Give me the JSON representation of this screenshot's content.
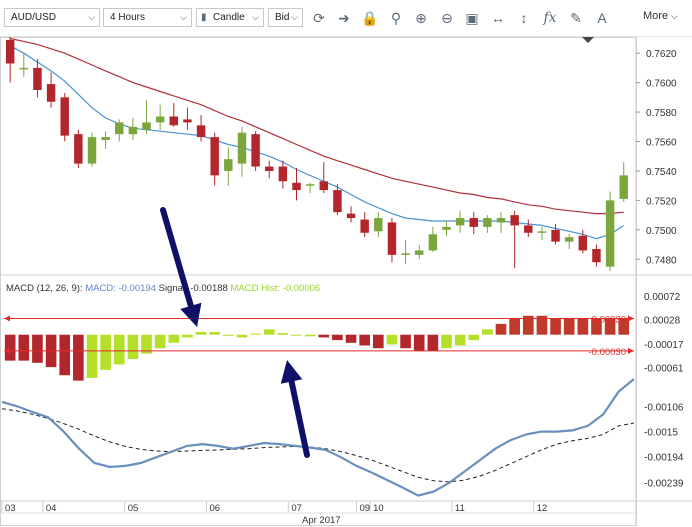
{
  "toolbar": {
    "symbol": "AUD/USD",
    "interval": "4 Hours",
    "chart_type": "Candle",
    "price_type": "Bid",
    "more_label": "More",
    "icons": [
      "refresh-icon",
      "arrow-right-icon",
      "lock-icon",
      "zoom-reset-icon",
      "zoom-in-icon",
      "zoom-out-icon",
      "zoom-fit-icon",
      "horizontal-resize-icon",
      "vertical-resize-icon",
      "function-icon",
      "pencil-icon",
      "text-tool-icon"
    ]
  },
  "chart_data": {
    "type": "candlestick",
    "symbol": "AUD/USD",
    "price_axis": {
      "ticks": [
        "0.7620",
        "0.7600",
        "0.7580",
        "0.7560",
        "0.7540",
        "0.7520",
        "0.7500",
        "0.7480"
      ],
      "range": [
        0.747,
        0.7631
      ]
    },
    "candles": [
      {
        "o": 0.7629,
        "h": 0.7632,
        "l": 0.76,
        "c": 0.7613
      },
      {
        "o": 0.761,
        "h": 0.762,
        "l": 0.7604,
        "c": 0.761
      },
      {
        "o": 0.761,
        "h": 0.7616,
        "l": 0.759,
        "c": 0.7595
      },
      {
        "o": 0.7599,
        "h": 0.7607,
        "l": 0.7583,
        "c": 0.7587
      },
      {
        "o": 0.759,
        "h": 0.7593,
        "l": 0.756,
        "c": 0.7564
      },
      {
        "o": 0.7565,
        "h": 0.7568,
        "l": 0.7542,
        "c": 0.7545
      },
      {
        "o": 0.7545,
        "h": 0.7566,
        "l": 0.7543,
        "c": 0.7563
      },
      {
        "o": 0.7561,
        "h": 0.7567,
        "l": 0.7555,
        "c": 0.7563
      },
      {
        "o": 0.7565,
        "h": 0.7575,
        "l": 0.756,
        "c": 0.7573
      },
      {
        "o": 0.7565,
        "h": 0.7576,
        "l": 0.7561,
        "c": 0.757
      },
      {
        "o": 0.7568,
        "h": 0.7588,
        "l": 0.7565,
        "c": 0.7573
      },
      {
        "o": 0.7573,
        "h": 0.7585,
        "l": 0.7568,
        "c": 0.7577
      },
      {
        "o": 0.7577,
        "h": 0.7586,
        "l": 0.757,
        "c": 0.7571
      },
      {
        "o": 0.7575,
        "h": 0.7583,
        "l": 0.7568,
        "c": 0.7573
      },
      {
        "o": 0.7571,
        "h": 0.7578,
        "l": 0.756,
        "c": 0.7563
      },
      {
        "o": 0.7563,
        "h": 0.7566,
        "l": 0.753,
        "c": 0.7537
      },
      {
        "o": 0.754,
        "h": 0.7556,
        "l": 0.753,
        "c": 0.7548
      },
      {
        "o": 0.7545,
        "h": 0.757,
        "l": 0.7536,
        "c": 0.7566
      },
      {
        "o": 0.7565,
        "h": 0.7567,
        "l": 0.754,
        "c": 0.7543
      },
      {
        "o": 0.7543,
        "h": 0.7547,
        "l": 0.7535,
        "c": 0.754
      },
      {
        "o": 0.7543,
        "h": 0.7547,
        "l": 0.7528,
        "c": 0.7533
      },
      {
        "o": 0.7532,
        "h": 0.7542,
        "l": 0.752,
        "c": 0.7527
      },
      {
        "o": 0.753,
        "h": 0.7532,
        "l": 0.7525,
        "c": 0.7531
      },
      {
        "o": 0.7533,
        "h": 0.7546,
        "l": 0.7525,
        "c": 0.7527
      },
      {
        "o": 0.7527,
        "h": 0.7531,
        "l": 0.751,
        "c": 0.7512
      },
      {
        "o": 0.7511,
        "h": 0.7516,
        "l": 0.7505,
        "c": 0.7508
      },
      {
        "o": 0.7507,
        "h": 0.7512,
        "l": 0.7495,
        "c": 0.7498
      },
      {
        "o": 0.7499,
        "h": 0.7512,
        "l": 0.7495,
        "c": 0.7508
      },
      {
        "o": 0.7505,
        "h": 0.7508,
        "l": 0.7478,
        "c": 0.7483
      },
      {
        "o": 0.7484,
        "h": 0.7493,
        "l": 0.7477,
        "c": 0.7484
      },
      {
        "o": 0.7483,
        "h": 0.749,
        "l": 0.748,
        "c": 0.7486
      },
      {
        "o": 0.7486,
        "h": 0.7502,
        "l": 0.7485,
        "c": 0.7497
      },
      {
        "o": 0.75,
        "h": 0.7506,
        "l": 0.7496,
        "c": 0.7502
      },
      {
        "o": 0.7503,
        "h": 0.7513,
        "l": 0.7498,
        "c": 0.7508
      },
      {
        "o": 0.7508,
        "h": 0.7512,
        "l": 0.7497,
        "c": 0.7502
      },
      {
        "o": 0.7502,
        "h": 0.751,
        "l": 0.7498,
        "c": 0.7508
      },
      {
        "o": 0.7505,
        "h": 0.7512,
        "l": 0.7498,
        "c": 0.7508
      },
      {
        "o": 0.751,
        "h": 0.7513,
        "l": 0.7474,
        "c": 0.7503
      },
      {
        "o": 0.7503,
        "h": 0.7507,
        "l": 0.7495,
        "c": 0.7498
      },
      {
        "o": 0.7498,
        "h": 0.7502,
        "l": 0.7493,
        "c": 0.7499
      },
      {
        "o": 0.75,
        "h": 0.7504,
        "l": 0.749,
        "c": 0.7492
      },
      {
        "o": 0.7492,
        "h": 0.7497,
        "l": 0.7487,
        "c": 0.7495
      },
      {
        "o": 0.7496,
        "h": 0.75,
        "l": 0.7484,
        "c": 0.7486
      },
      {
        "o": 0.7487,
        "h": 0.749,
        "l": 0.7475,
        "c": 0.7478
      },
      {
        "o": 0.7475,
        "h": 0.7526,
        "l": 0.7472,
        "c": 0.752
      },
      {
        "o": 0.7521,
        "h": 0.7546,
        "l": 0.7519,
        "c": 0.7537
      }
    ],
    "ma_fast": [
      0.7625,
      0.762,
      0.7614,
      0.7608,
      0.7601,
      0.7592,
      0.7583,
      0.7576,
      0.7572,
      0.7569,
      0.7568,
      0.7567,
      0.7566,
      0.7565,
      0.7564,
      0.7561,
      0.7558,
      0.7556,
      0.7553,
      0.755,
      0.7546,
      0.7541,
      0.7537,
      0.7533,
      0.7529,
      0.7524,
      0.7519,
      0.7515,
      0.7511,
      0.7508,
      0.7507,
      0.7506,
      0.7506,
      0.7506,
      0.7506,
      0.7506,
      0.7506,
      0.7505,
      0.7504,
      0.7503,
      0.7501,
      0.7499,
      0.7497,
      0.7494,
      0.7497,
      0.7503
    ],
    "ma_slow": [
      0.763,
      0.7628,
      0.7626,
      0.7623,
      0.762,
      0.7616,
      0.7612,
      0.7608,
      0.7604,
      0.76,
      0.7597,
      0.7594,
      0.7591,
      0.7588,
      0.7585,
      0.7581,
      0.7577,
      0.7574,
      0.757,
      0.7566,
      0.7562,
      0.7558,
      0.7554,
      0.755,
      0.7547,
      0.7544,
      0.7541,
      0.7538,
      0.7535,
      0.7533,
      0.7531,
      0.7529,
      0.7527,
      0.7525,
      0.7524,
      0.7522,
      0.7521,
      0.7519,
      0.7517,
      0.7516,
      0.7514,
      0.7513,
      0.7512,
      0.7511,
      0.7511,
      0.7512
    ],
    "macd": {
      "legend_name": "MACD (12, 26, 9):",
      "legend_macd": "MACD: -0.00194",
      "legend_signal": "Signal: -0.00188",
      "legend_hist": "MACD Hist: -0.00006",
      "hist_axis_ticks": [
        "0.00072",
        "0.00028",
        "-0.00017",
        "-0.00061"
      ],
      "hist_range": [
        -0.00082,
        0.00092
      ],
      "histogram": [
        -0.00048,
        -0.00048,
        -0.00052,
        -0.0006,
        -0.00075,
        -0.00085,
        -0.0008,
        -0.00065,
        -0.00055,
        -0.00045,
        -0.00035,
        -0.00025,
        -0.00015,
        -5e-05,
        5e-05,
        5e-05,
        -2e-05,
        -5e-05,
        2e-05,
        0.0001,
        3e-05,
        -1e-05,
        -3e-05,
        -5e-05,
        -0.0001,
        -0.00015,
        -0.0002,
        -0.00025,
        -0.00018,
        -0.00025,
        -0.0003,
        -0.0003,
        -0.00025,
        -0.0002,
        -0.0001,
        0.0001,
        0.0002,
        0.0003,
        0.00035,
        0.00035,
        0.0003,
        0.0003,
        0.0003,
        0.0003,
        0.0003,
        0.0003,
        0.0009
      ],
      "levels": [
        {
          "value": 0.0003,
          "label": "0.00030"
        },
        {
          "value": -0.0003,
          "label": "-0.00030"
        }
      ],
      "line_axis_ticks": [
        "-0.00106",
        "-0.0015",
        "-0.00194",
        "-0.00239"
      ],
      "line_range": [
        -0.00268,
        -0.00058
      ],
      "macd_line": [
        -0.00098,
        -0.00106,
        -0.00116,
        -0.00125,
        -0.0015,
        -0.0018,
        -0.00205,
        -0.00212,
        -0.0021,
        -0.00205,
        -0.00195,
        -0.00185,
        -0.00175,
        -0.00172,
        -0.00175,
        -0.0018,
        -0.00175,
        -0.0017,
        -0.00172,
        -0.00175,
        -0.00178,
        -0.00182,
        -0.00195,
        -0.0021,
        -0.00222,
        -0.00235,
        -0.00248,
        -0.00262,
        -0.00255,
        -0.0024,
        -0.0022,
        -0.002,
        -0.0018,
        -0.00165,
        -0.00155,
        -0.0015,
        -0.0015,
        -0.00148,
        -0.0014,
        -0.0012,
        -0.0008,
        -0.00058
      ],
      "signal_line": [
        -0.0011,
        -0.00114,
        -0.0012,
        -0.00127,
        -0.00136,
        -0.00146,
        -0.00158,
        -0.00168,
        -0.00176,
        -0.00181,
        -0.00184,
        -0.00185,
        -0.00184,
        -0.00183,
        -0.00182,
        -0.00181,
        -0.0018,
        -0.00178,
        -0.00177,
        -0.00176,
        -0.00177,
        -0.0018,
        -0.00185,
        -0.00192,
        -0.002,
        -0.0021,
        -0.0022,
        -0.0023,
        -0.00236,
        -0.00238,
        -0.00235,
        -0.00228,
        -0.00218,
        -0.00206,
        -0.00194,
        -0.00182,
        -0.00172,
        -0.00166,
        -0.00162,
        -0.00155,
        -0.0014,
        -0.00135
      ]
    },
    "x_axis": {
      "day_ticks": [
        {
          "label": "03",
          "i": 0
        },
        {
          "label": "04",
          "i": 3
        },
        {
          "label": "05",
          "i": 9
        },
        {
          "label": "06",
          "i": 15
        },
        {
          "label": "07",
          "i": 21
        },
        {
          "label": "09",
          "i": 26
        },
        {
          "label": "10",
          "i": 27
        },
        {
          "label": "11",
          "i": 33
        },
        {
          "label": "12",
          "i": 39
        }
      ],
      "month_label": "Apr 2017"
    },
    "annotations": {
      "arrow_color": "#0f1166",
      "level_color": "#e32b2b"
    }
  },
  "colors": {
    "bull": "#7ba63c",
    "bear": "#b3262b",
    "ma_fast": "#4b93d4",
    "ma_slow": "#b3303a",
    "macd_line": "#6a8fbf",
    "signal_line": "#222"
  }
}
